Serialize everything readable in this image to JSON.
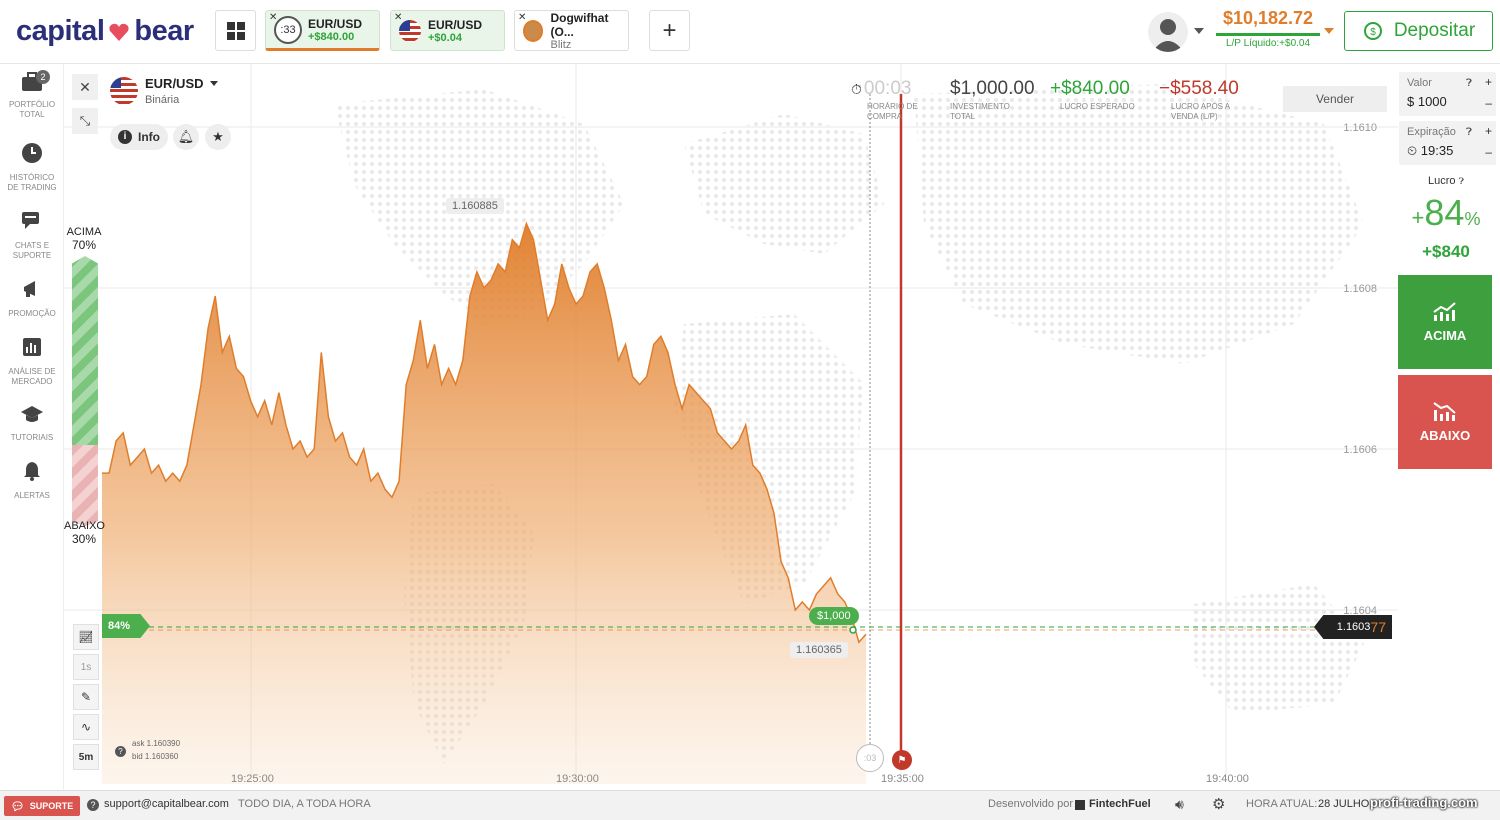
{
  "header": {
    "logo_left": "capital",
    "logo_right": "bear",
    "tabs": [
      {
        "timer": ":33",
        "title": "EUR/USD",
        "sub": "+$840.00"
      },
      {
        "title": "EUR/USD",
        "sub": "+$0.04"
      },
      {
        "title": "Dogwifhat (O...",
        "sub": "Blitz"
      }
    ],
    "balance": "$10,182.72",
    "lp": "L/P Líquido:+$0.04",
    "deposit_label": "Depositar"
  },
  "sidebar": {
    "items": [
      {
        "label": "PORTFÓLIO TOTAL",
        "badge": "2"
      },
      {
        "label": "HISTÓRICO DE TRADING"
      },
      {
        "label": "CHATS E SUPORTE"
      },
      {
        "label": "PROMOÇÃO"
      },
      {
        "label": "ANÁLISE DE MERCADO"
      },
      {
        "label": "TUTORIAIS"
      },
      {
        "label": "ALERTAS"
      }
    ]
  },
  "asset": {
    "name": "EUR/USD",
    "type": "Binária",
    "info": "Info"
  },
  "stats": {
    "timer": "00:03",
    "timer_label": "HORÁRIO DE COMPRA",
    "investment": "$1,000.00",
    "investment_label": "INVESTIMENTO TOTAL",
    "expected": "+$840.00",
    "expected_label": "LUCRO ESPERADO",
    "after_sale": "−$558.40",
    "after_sale_label": "LUCRO APÓS A VENDA (L/P)",
    "sell": "Vender"
  },
  "sentiment": {
    "up_label": "ACIMA",
    "up_pct": "70%",
    "down_label": "ABAIXO",
    "down_pct": "30%"
  },
  "chart": {
    "peak_label": "1.160885",
    "entry_label": "1.160365",
    "position_label": "$1,000",
    "payout_tag": "84%",
    "current_price_prefix": "1.1603",
    "current_price_suffix": "77",
    "y_ticks": [
      "1.1610",
      "1.1608",
      "1.1606",
      "1.1604"
    ],
    "x_ticks": [
      "19:25:00",
      "19:30:00",
      "19:35:00",
      "19:40:00"
    ],
    "ask": "ask 1.160390",
    "bid": "bid 1.160360",
    "timer_small": ":03",
    "tool_interval": "1s",
    "tool_timeframe": "5m"
  },
  "panel": {
    "value_label": "Valor",
    "value": "$ 1000",
    "expiry_label": "Expiração",
    "expiry": "19:35",
    "profit_label": "Lucro",
    "profit_pct_sign": "+",
    "profit_pct": "84",
    "profit_pct_unit": "%",
    "profit_amount": "+$840",
    "up_label": "ACIMA",
    "down_label": "ABAIXO"
  },
  "footer": {
    "support": "SUPORTE",
    "email": "support@capitalbear.com",
    "hours": "TODO DIA, A TODA HORA",
    "dev_prefix": "Desenvolvido por",
    "dev_name": "FintechFuel",
    "time_prefix": "HORA ATUAL:",
    "time_value": "28 JULHO,",
    "watermark": "profi-trading.com"
  },
  "colors": {
    "accent_orange": "#e07d2a",
    "green": "#2ea43a",
    "red": "#d9534f",
    "brand_navy": "#2b2f7a"
  },
  "chart_data": {
    "type": "area",
    "series": [
      {
        "values": [
          1.16057,
          1.16057,
          1.16061,
          1.16062,
          1.16058,
          1.16059,
          1.1606,
          1.16057,
          1.16058,
          1.16056,
          1.16057,
          1.16056,
          1.16058,
          1.16063,
          1.16068,
          1.16075,
          1.16079,
          1.16072,
          1.16074,
          1.1607,
          1.16069,
          1.16066,
          1.16064,
          1.16066,
          1.16063,
          1.16067,
          1.16063,
          1.1606,
          1.16061,
          1.16059,
          1.1606,
          1.16072,
          1.16064,
          1.16061,
          1.16062,
          1.16059,
          1.16058,
          1.1606,
          1.16056,
          1.16057,
          1.16055,
          1.16054,
          1.16056,
          1.16068,
          1.16071,
          1.16076,
          1.1607,
          1.16073,
          1.16068,
          1.1607,
          1.16068,
          1.16071,
          1.16079,
          1.16082,
          1.1608,
          1.16081,
          1.16083,
          1.16082,
          1.16086,
          1.16085,
          1.16088,
          1.16086,
          1.16081,
          1.16076,
          1.16078,
          1.16083,
          1.1608,
          1.16078,
          1.16079,
          1.16082,
          1.16083,
          1.1608,
          1.16076,
          1.16071,
          1.16073,
          1.16069,
          1.16068,
          1.16069,
          1.16073,
          1.16074,
          1.16072,
          1.16068,
          1.16065,
          1.16068,
          1.16067,
          1.16066,
          1.16065,
          1.16062,
          1.16061,
          1.1606,
          1.16061,
          1.16063,
          1.16058,
          1.16057,
          1.16055,
          1.16052,
          1.16046,
          1.16044,
          1.1604,
          1.16041,
          1.1604,
          1.16042,
          1.16043,
          1.16044,
          1.16042,
          1.16041,
          1.16039,
          1.16036,
          1.16037
        ]
      }
    ],
    "ylim": [
      1.16025,
      1.1612
    ],
    "y_ticks": [
      1.161,
      1.1608,
      1.1606,
      1.1604
    ]
  }
}
